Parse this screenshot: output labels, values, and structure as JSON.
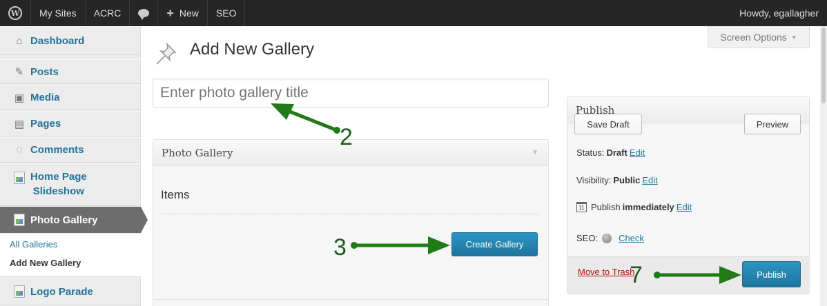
{
  "adminbar": {
    "logo": "wordpress-icon",
    "my_sites": "My Sites",
    "site_name": "ACRC",
    "comments_icon": "comment-bubble-icon",
    "new_label": "New",
    "new_icon": "+",
    "seo": "SEO",
    "howdy": "Howdy, egallagher"
  },
  "sidebar": {
    "items": [
      {
        "label": "Dashboard",
        "icon": "⌂"
      },
      {
        "label": "Posts",
        "icon": "✎"
      },
      {
        "label": "Media",
        "icon": "▣"
      },
      {
        "label": "Pages",
        "icon": "▤"
      },
      {
        "label": "Comments",
        "icon": "◌"
      },
      {
        "label": "Home Page",
        "label2": "Slideshow",
        "icon": "broken-image-icon"
      },
      {
        "label": "Photo Gallery",
        "icon": "broken-image-icon"
      },
      {
        "label": "Logo Parade",
        "icon": "broken-image-icon"
      }
    ],
    "submenu": [
      "All Galleries",
      "Add New Gallery"
    ]
  },
  "header": {
    "title": "Add New Gallery",
    "screen_options": "Screen Options",
    "icon": "pushpin-icon"
  },
  "title_input": {
    "placeholder": "Enter photo gallery title"
  },
  "photo_gallery_box": {
    "title": "Photo Gallery",
    "items_label": "Items",
    "create_button": "Create Gallery"
  },
  "publish_box": {
    "title": "Publish",
    "save_draft": "Save Draft",
    "preview": "Preview",
    "status_label": "Status:",
    "status_value": "Draft",
    "visibility_label": "Visibility:",
    "visibility_value": "Public",
    "publish_label": "Publish",
    "publish_value": "immediately",
    "seo_label": "SEO:",
    "seo_check": "Check",
    "edit": "Edit",
    "trash": "Move to Trash",
    "publish_button": "Publish"
  },
  "annotations": [
    "2",
    "3",
    "7"
  ],
  "colors": {
    "admin_bar": "#262626",
    "link": "#21759b",
    "primary_button": "#21759b",
    "annotation_arrow": "#1f7a17",
    "trash_link": "#bc0b0b"
  }
}
